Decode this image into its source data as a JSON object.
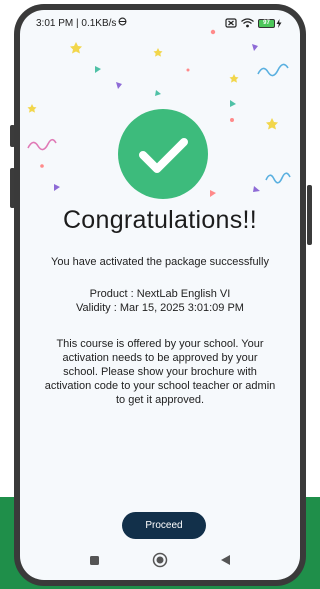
{
  "status_bar": {
    "time_speed": "3:01 PM | 0.1KB/s",
    "battery_level": "97"
  },
  "main": {
    "title": "Congratulations!!",
    "subtitle": "You have activated the package successfully",
    "product_line": "Product : NextLab English VI",
    "validity_line": "Validity : Mar 15, 2025 3:01:09 PM",
    "info_text": "This course is offered by your school. Your activation needs to be approved by your school. Please show your brochure with activation code to your school teacher or admin to get it approved."
  },
  "actions": {
    "proceed_label": "Proceed"
  },
  "colors": {
    "success_green": "#3dbb7c",
    "button_navy": "#12304a",
    "background_green": "#1f8f4a"
  },
  "icons": {
    "check": "check-icon",
    "back": "back-icon",
    "home": "home-icon",
    "recents": "recents-icon"
  }
}
